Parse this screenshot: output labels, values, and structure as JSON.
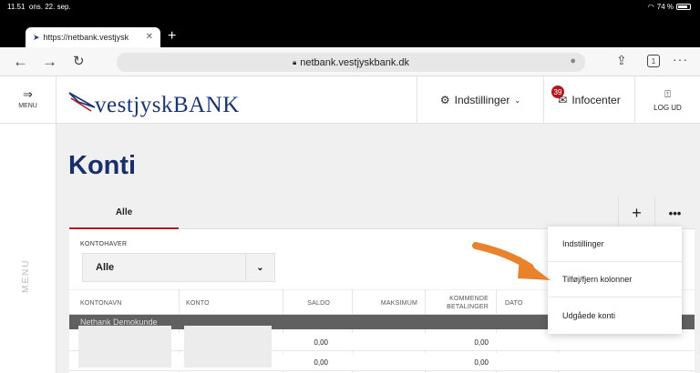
{
  "status": {
    "time": "11.51",
    "date": "ons. 22. sep.",
    "battery": "74 %"
  },
  "browser": {
    "tab_title": "https://netbank.vestjysk",
    "address": "netbank.vestjyskbank.dk",
    "tab_count": "1"
  },
  "header": {
    "menu_label": "MENU",
    "logo_text": "vestjyskBANK",
    "settings_label": "Indstillinger",
    "infocenter_label": "Infocenter",
    "infocenter_badge": "39",
    "logout_label": "LOG UD"
  },
  "rail": {
    "label": "MENU"
  },
  "page": {
    "title": "Konti"
  },
  "tabs": {
    "active": "Alle"
  },
  "filter": {
    "label": "KONTOHAVER",
    "selected": "Alle"
  },
  "table": {
    "columns": [
      "KONTONAVN",
      "KONTO",
      "SALDO",
      "MAKSIMUM",
      "KOMMENDE BETALINGER",
      "DATO"
    ],
    "group_label": "Nethank Demokunde",
    "rows": [
      {
        "saldo": "0,00",
        "kommende": "0,00"
      },
      {
        "saldo": "0,00",
        "kommende": "0,00"
      }
    ]
  },
  "dropdown": {
    "items": [
      "Indstillinger",
      "Tilføj/fjern kolonner",
      "Udgåede konti"
    ]
  },
  "colors": {
    "brand_blue": "#1a2e6b",
    "brand_red": "#b3181e",
    "arrow_orange": "#e9822c"
  }
}
